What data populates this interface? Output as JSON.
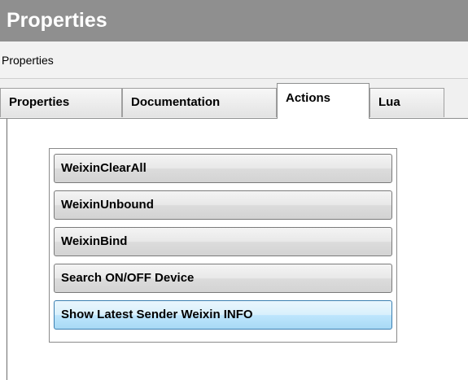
{
  "window": {
    "title": "Properties"
  },
  "panel": {
    "header": "Properties"
  },
  "tabs": [
    {
      "label": "Properties"
    },
    {
      "label": "Documentation"
    },
    {
      "label": "Actions",
      "active": true
    },
    {
      "label": "Lua"
    }
  ],
  "actions": [
    {
      "label": "WeixinClearAll"
    },
    {
      "label": "WeixinUnbound"
    },
    {
      "label": "WeixinBind"
    },
    {
      "label": "Search ON/OFF Device"
    },
    {
      "label": "Show Latest Sender Weixin INFO",
      "hovered": true
    }
  ],
  "colors": {
    "titlebar": "#8f8f8f",
    "hover_border": "#3c7fb1",
    "hover_fill": "#bee6fd"
  }
}
